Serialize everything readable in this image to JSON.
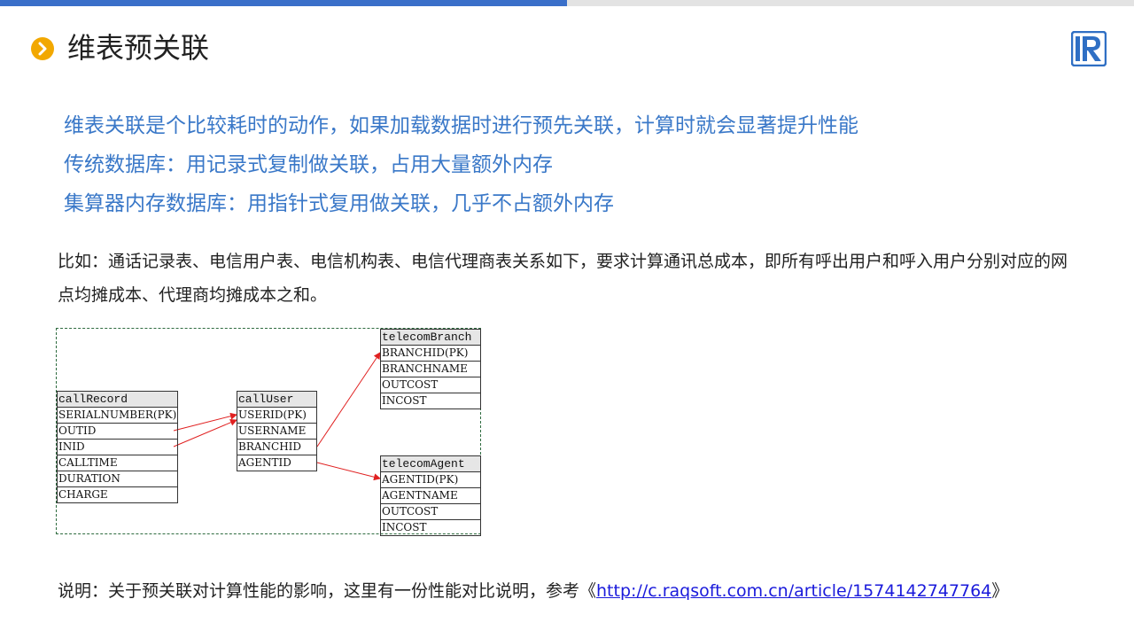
{
  "header": {
    "title": "维表预关联",
    "accent_color": "#3a6fc9",
    "bullet_color": "#f2a800",
    "bullet_icon": "chevron-right-icon",
    "logo_icon": "r-logo-icon"
  },
  "highlights": [
    "维表关联是个比较耗时的动作，如果加载数据时进行预先关联，计算时就会显著提升性能",
    "传统数据库：用记录式复制做关联，占用大量额外内存",
    "集算器内存数据库：用指针式复用做关联，几乎不占额外内存"
  ],
  "example": {
    "text": "比如：通话记录表、电信用户表、电信机构表、电信代理商表关系如下，要求计算通讯总成本，即所有呼出用户和呼入用户分别对应的网点均摊成本、代理商均摊成本之和。"
  },
  "diagram": {
    "tables": [
      {
        "name": "callRecord",
        "fields": [
          "SERIALNUMBER(PK)",
          "OUTID",
          "INID",
          "CALLTIME",
          "DURATION",
          "CHARGE"
        ]
      },
      {
        "name": "callUser",
        "fields": [
          "USERID(PK)",
          "USERNAME",
          "BRANCHID",
          "AGENTID"
        ]
      },
      {
        "name": "telecomBranch",
        "fields": [
          "BRANCHID(PK)",
          "BRANCHNAME",
          "OUTCOST",
          "INCOST"
        ]
      },
      {
        "name": "telecomAgent",
        "fields": [
          "AGENTID(PK)",
          "AGENTNAME",
          "OUTCOST",
          "INCOST"
        ]
      }
    ],
    "arrow_color": "#e02020",
    "border_color": "#2e6b3f"
  },
  "note": {
    "prefix": "说明：关于预关联对计算性能的影响，这里有一份性能对比说明，参考《",
    "link": "http://c.raqsoft.com.cn/article/1574142747764",
    "suffix": "》"
  }
}
